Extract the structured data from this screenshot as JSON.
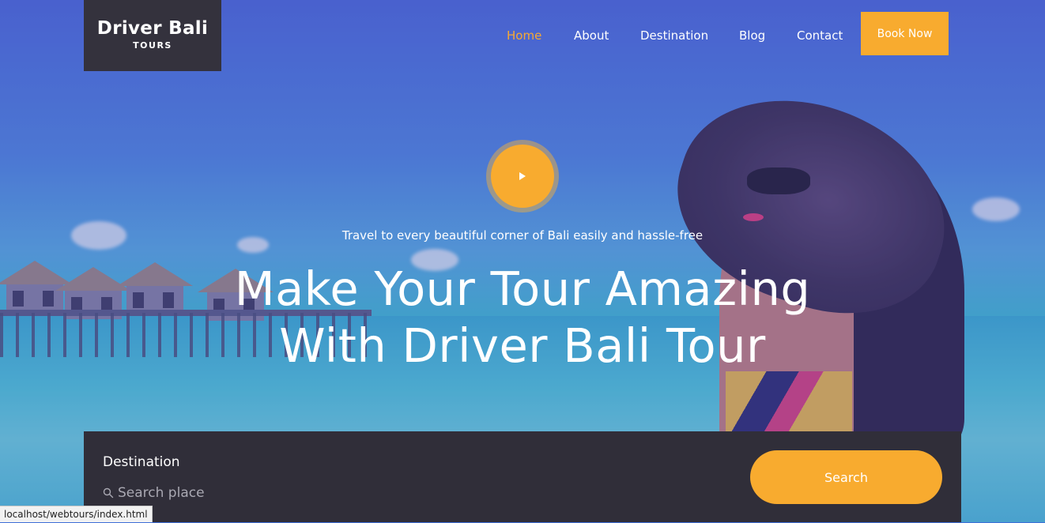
{
  "logo": {
    "title": "Driver Bali",
    "subtitle": "TOURS"
  },
  "nav": {
    "items": [
      {
        "label": "Home",
        "active": true
      },
      {
        "label": "About",
        "active": false
      },
      {
        "label": "Destination",
        "active": false
      },
      {
        "label": "Blog",
        "active": false
      },
      {
        "label": "Contact",
        "active": false
      }
    ],
    "book_label": "Book Now"
  },
  "hero": {
    "tagline": "Travel to every beautiful corner of Bali easily and hassle-free",
    "headline_line1": "Make Your Tour Amazing",
    "headline_line2": "With Driver Bali Tour",
    "play_icon": "play-icon"
  },
  "search": {
    "label": "Destination",
    "placeholder": "Search place",
    "value": "",
    "button_label": "Search",
    "icon": "search-icon"
  },
  "status_bar": {
    "url": "localhost/webtours/index.html"
  },
  "colors": {
    "accent": "#f8ab2f",
    "dark_panel": "#302e39",
    "logo_bg": "#34323d",
    "nav_text": "#ffffff"
  }
}
